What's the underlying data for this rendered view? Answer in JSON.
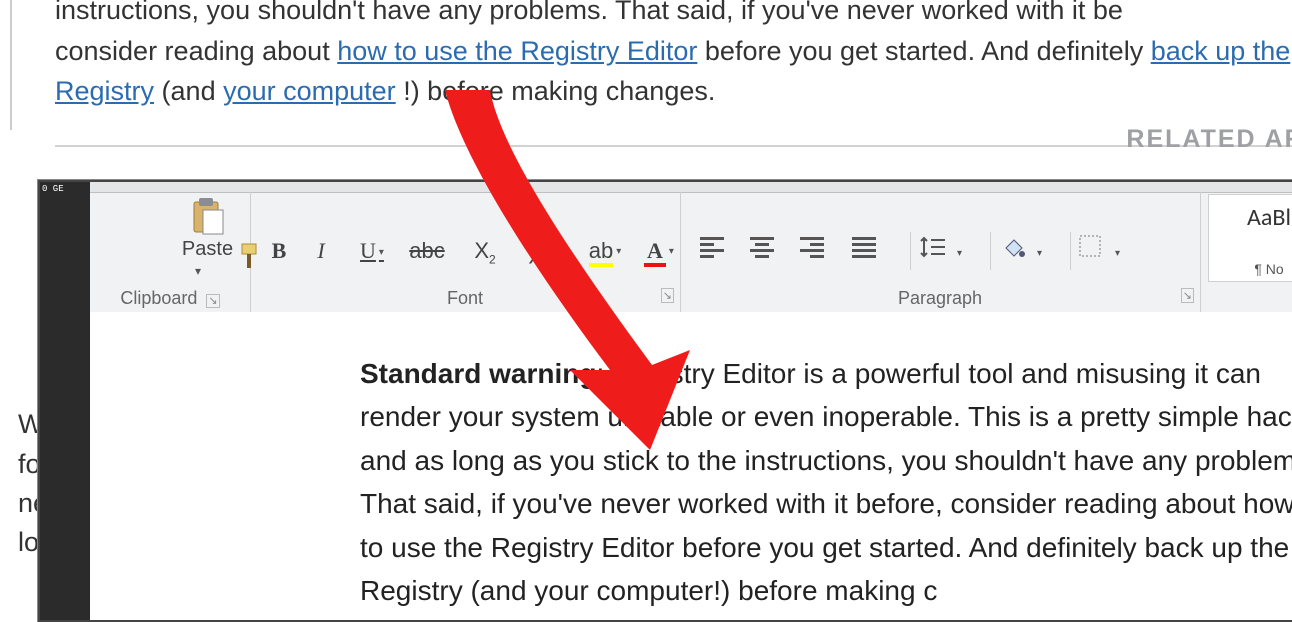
{
  "article": {
    "line1_pre": "instructions, you shouldn't have any problems. That said, if you've never worked with it be",
    "line2_pre": "consider reading about ",
    "link_registry_editor": "how to use the Registry Editor",
    "line2_mid": " before you get started. And definitely ",
    "link_backup": "back up the Registry",
    "line3_mid": " (and ",
    "link_computer": "your computer",
    "line3_end": "!) before making changes.",
    "related_label": "RELATED ART"
  },
  "bg_left": {
    "l1": "We",
    "l2": "for",
    "l3": "nee",
    "l4": "log"
  },
  "ribbon": {
    "clipboard": {
      "paste": "Paste",
      "label": "Clipboard"
    },
    "font": {
      "label": "Font",
      "bold": "B",
      "italic": "I",
      "underline": "U",
      "strike": "abc",
      "sub_x": "X",
      "sub_2": "2",
      "sup_x": "X",
      "sup_2": "2",
      "highlight_text": "ab",
      "fontcolor_letter": "A"
    },
    "paragraph": {
      "label": "Paragraph"
    },
    "styles": {
      "preview": "AaBl",
      "name": "¶ No"
    }
  },
  "thumb": {
    "text": "0 GE"
  },
  "doc": {
    "bold_lead": "Standard warning",
    "body": ": Registry Editor is a powerful tool and misusing it can render your system unstable or even inoperable. This is a pretty simple hack and as long as you stick to the instructions, you shouldn't have any problems. That said, if you've never worked with it before, consider reading about how to use the Registry Editor before you get started. And definitely back up the Registry (and your computer!) before making c"
  }
}
